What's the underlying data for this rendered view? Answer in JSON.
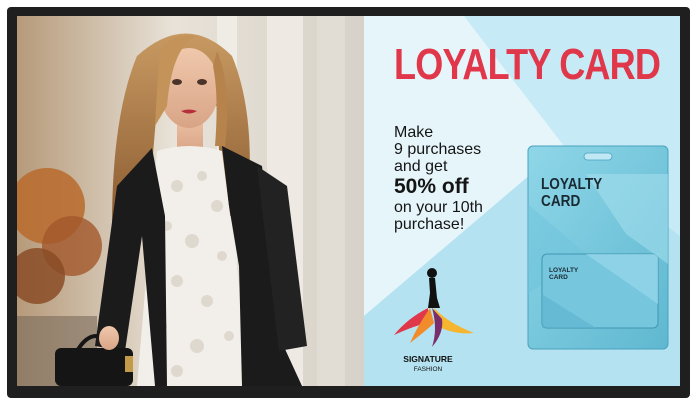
{
  "ad": {
    "title": "LOYALTY CARD",
    "copy_line1": "Make",
    "copy_line2": "9 purchases",
    "copy_line3": "and get",
    "copy_highlight": "50% off",
    "copy_line4": "on your 10th",
    "copy_line5": "purchase!",
    "card_title_line1": "LOYALTY",
    "card_title_line2": "CARD",
    "mini_card_line1": "LOYALTY",
    "mini_card_line2": "CARD"
  },
  "brand": {
    "name": "SIGNATURE",
    "subtitle": "FASHION"
  },
  "colors": {
    "title_red": "#e0374a",
    "ad_background": "#bfe7f4",
    "card_teal": "#7fcfe3",
    "bezel": "#1f1f1f"
  },
  "icons": [
    "fashion-logo-icon"
  ]
}
